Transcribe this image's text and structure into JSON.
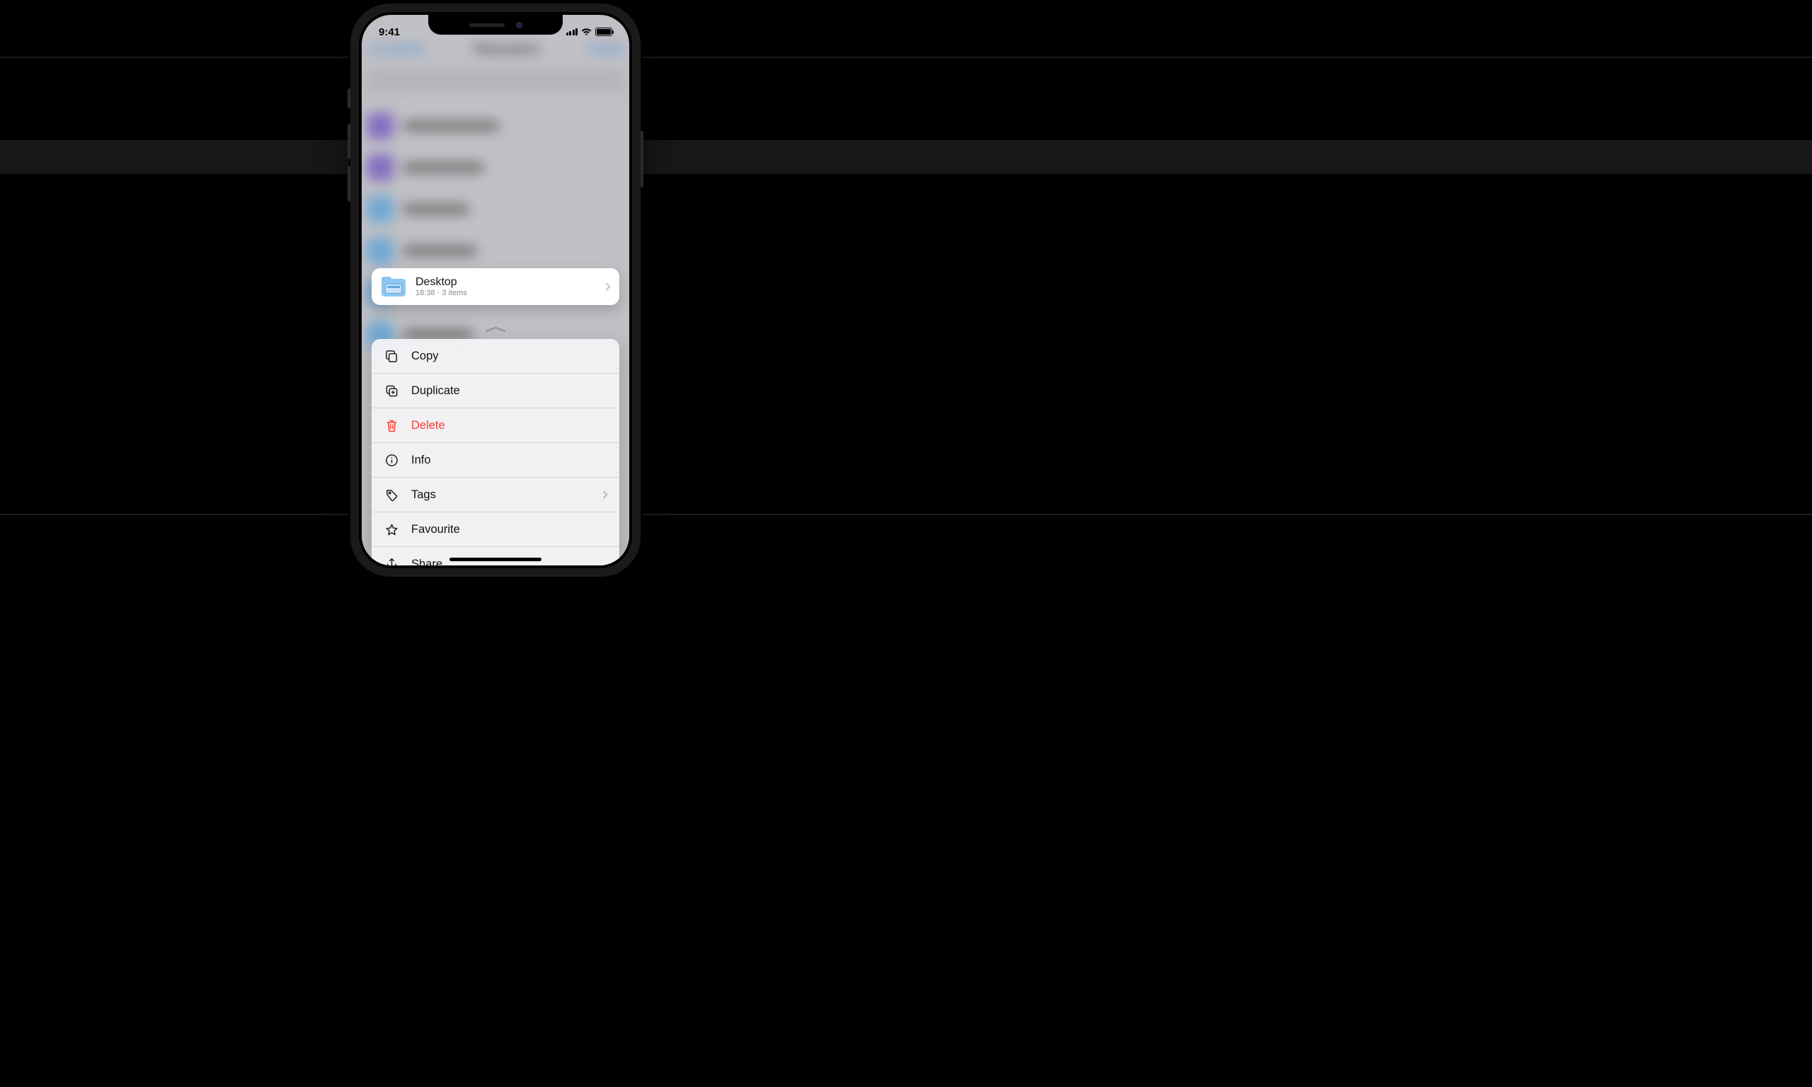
{
  "status": {
    "time": "9:41"
  },
  "nav": {
    "back": "Locations",
    "title": "Relocation",
    "action": "Select"
  },
  "preview": {
    "name": "Desktop",
    "subtitle": "18:38 · 3 items"
  },
  "menu": {
    "copy": {
      "label": "Copy"
    },
    "duplicate": {
      "label": "Duplicate"
    },
    "delete": {
      "label": "Delete"
    },
    "info": {
      "label": "Info"
    },
    "tags": {
      "label": "Tags"
    },
    "favourite": {
      "label": "Favourite"
    },
    "share": {
      "label": "Share"
    }
  }
}
